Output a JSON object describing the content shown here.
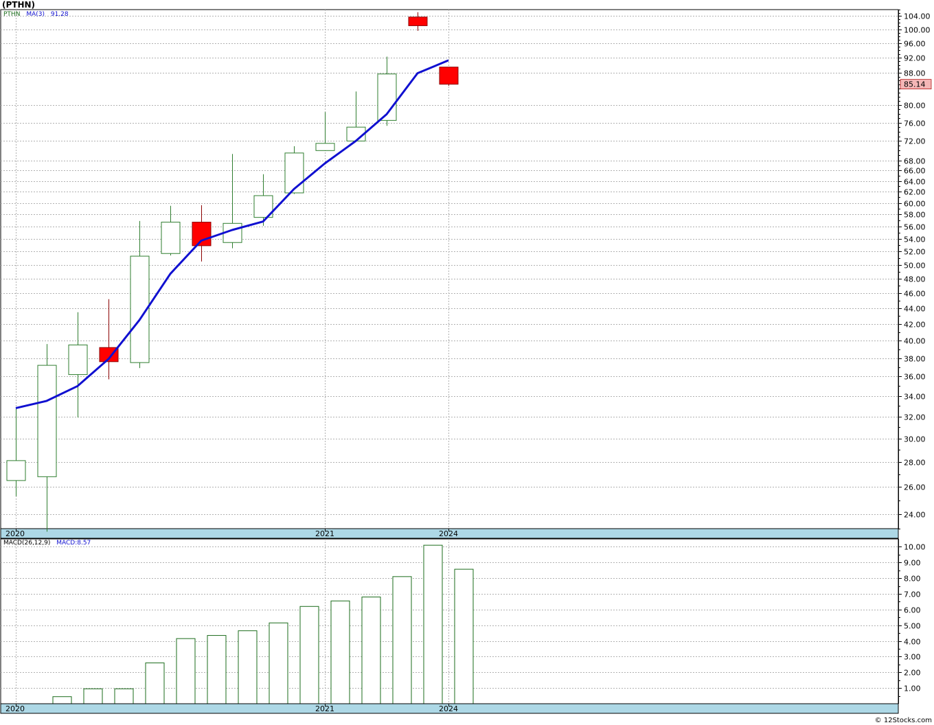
{
  "title": "(PTHN)",
  "legend": {
    "ticker": "PTHN",
    "ma_label": "MA(3)",
    "ma_value": "91.28"
  },
  "macd_legend": {
    "label": "MACD(26,12,9)",
    "value_label": "MACD:8.57"
  },
  "last_price_badge": "85.14",
  "footer": "© 12Stocks.com",
  "colors": {
    "up_candle": "#ffffff",
    "down_candle": "#ff0000",
    "up_wick": "#2e7d2e",
    "down_wick": "#8b0000",
    "ma_line": "#1010d0",
    "macd_bar_outline": "#1a6b1a",
    "axis_band": "#add8e6",
    "grid": "#b0b0b0",
    "badge_bg": "#f4b6b6"
  },
  "chart_data": [
    {
      "type": "candlestick",
      "scale": "log",
      "ylim": [
        23,
        106
      ],
      "yticks": [
        "24.00",
        "26.00",
        "28.00",
        "30.00",
        "32.00",
        "34.00",
        "36.00",
        "38.00",
        "40.00",
        "42.00",
        "44.00",
        "46.00",
        "48.00",
        "50.00",
        "52.00",
        "54.00",
        "56.00",
        "58.00",
        "60.00",
        "62.00",
        "64.00",
        "66.00",
        "68.00",
        "72.00",
        "76.00",
        "80.00",
        "88.00",
        "92.00",
        "96.00",
        "100.00",
        "104.00"
      ],
      "xlabels": [
        {
          "label": "2020",
          "index": 0
        },
        {
          "label": "2021",
          "index": 10
        },
        {
          "label": "2024",
          "index": 14
        }
      ],
      "candles": [
        {
          "open": 26.5,
          "close": 28.1,
          "high": 32.8,
          "low": 25.3
        },
        {
          "open": 26.8,
          "close": 37.2,
          "high": 39.6,
          "low": 22.8
        },
        {
          "open": 36.2,
          "close": 39.5,
          "high": 43.5,
          "low": 31.9
        },
        {
          "open": 39.2,
          "close": 37.6,
          "high": 45.2,
          "low": 35.7
        },
        {
          "open": 37.5,
          "close": 51.3,
          "high": 56.9,
          "low": 36.9
        },
        {
          "open": 51.7,
          "close": 56.7,
          "high": 59.5,
          "low": 51.4
        },
        {
          "open": 56.7,
          "close": 52.9,
          "high": 59.6,
          "low": 50.5
        },
        {
          "open": 53.4,
          "close": 56.5,
          "high": 69.3,
          "low": 52.5
        },
        {
          "open": 57.5,
          "close": 61.3,
          "high": 65.3,
          "low": 56.1
        },
        {
          "open": 61.8,
          "close": 69.5,
          "high": 70.9,
          "low": 61.6
        },
        {
          "open": 70.0,
          "close": 71.5,
          "high": 78.4,
          "low": 69.9
        },
        {
          "open": 72.0,
          "close": 75.0,
          "high": 83.3,
          "low": 71.8
        },
        {
          "open": 76.5,
          "close": 87.7,
          "high": 92.3,
          "low": 75.3
        },
        {
          "open": 103.7,
          "close": 101.1,
          "high": 105.2,
          "low": 99.6
        },
        {
          "open": 89.5,
          "close": 85.1,
          "high": 89.5,
          "low": 84.7
        }
      ],
      "ma": {
        "name": "MA(3)",
        "values": [
          32.8,
          33.5,
          35.0,
          37.9,
          42.5,
          48.7,
          53.7,
          55.4,
          56.8,
          62.5,
          67.4,
          72.0,
          77.9,
          87.9,
          91.3
        ]
      }
    },
    {
      "type": "bar",
      "ylim": [
        0,
        10.5
      ],
      "yticks": [
        "1.00",
        "2.00",
        "3.00",
        "4.00",
        "5.00",
        "6.00",
        "7.00",
        "8.00",
        "9.00",
        "10.00"
      ],
      "xlabels": [
        {
          "label": "2020",
          "index": 0
        },
        {
          "label": "2021",
          "index": 10
        },
        {
          "label": "2024",
          "index": 14
        }
      ],
      "values": [
        0.0,
        0.45,
        0.95,
        0.95,
        2.6,
        4.15,
        4.35,
        4.65,
        5.15,
        6.2,
        6.55,
        6.8,
        8.1,
        10.1,
        8.57
      ]
    }
  ]
}
